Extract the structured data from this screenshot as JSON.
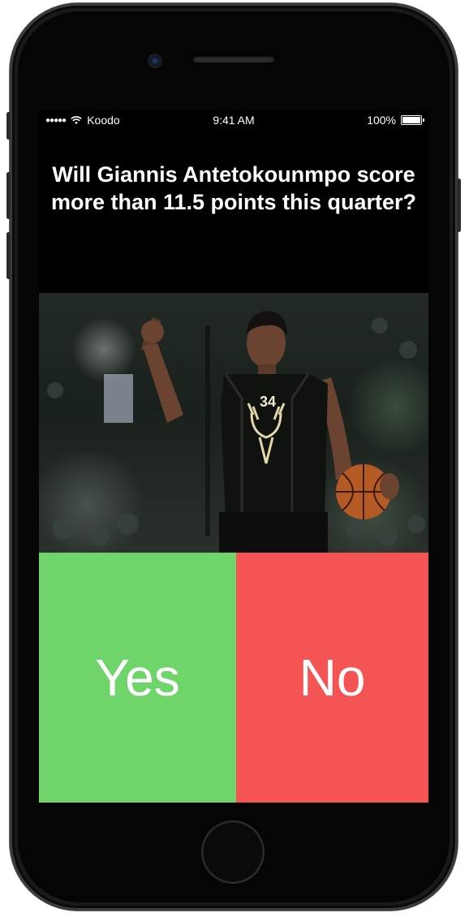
{
  "status_bar": {
    "signal": "●●●●●",
    "carrier": "Koodo",
    "time": "9:41 AM",
    "battery": "100%",
    "battery_level": 1.0
  },
  "question": {
    "text": "Will Giannis Antetokounmpo score more than 11.5 points this quarter?"
  },
  "player_photo": {
    "jersey_number": "34"
  },
  "answers": {
    "yes_label": "Yes",
    "no_label": "No",
    "yes_color": "#6fd46a",
    "no_color": "#f55454"
  }
}
